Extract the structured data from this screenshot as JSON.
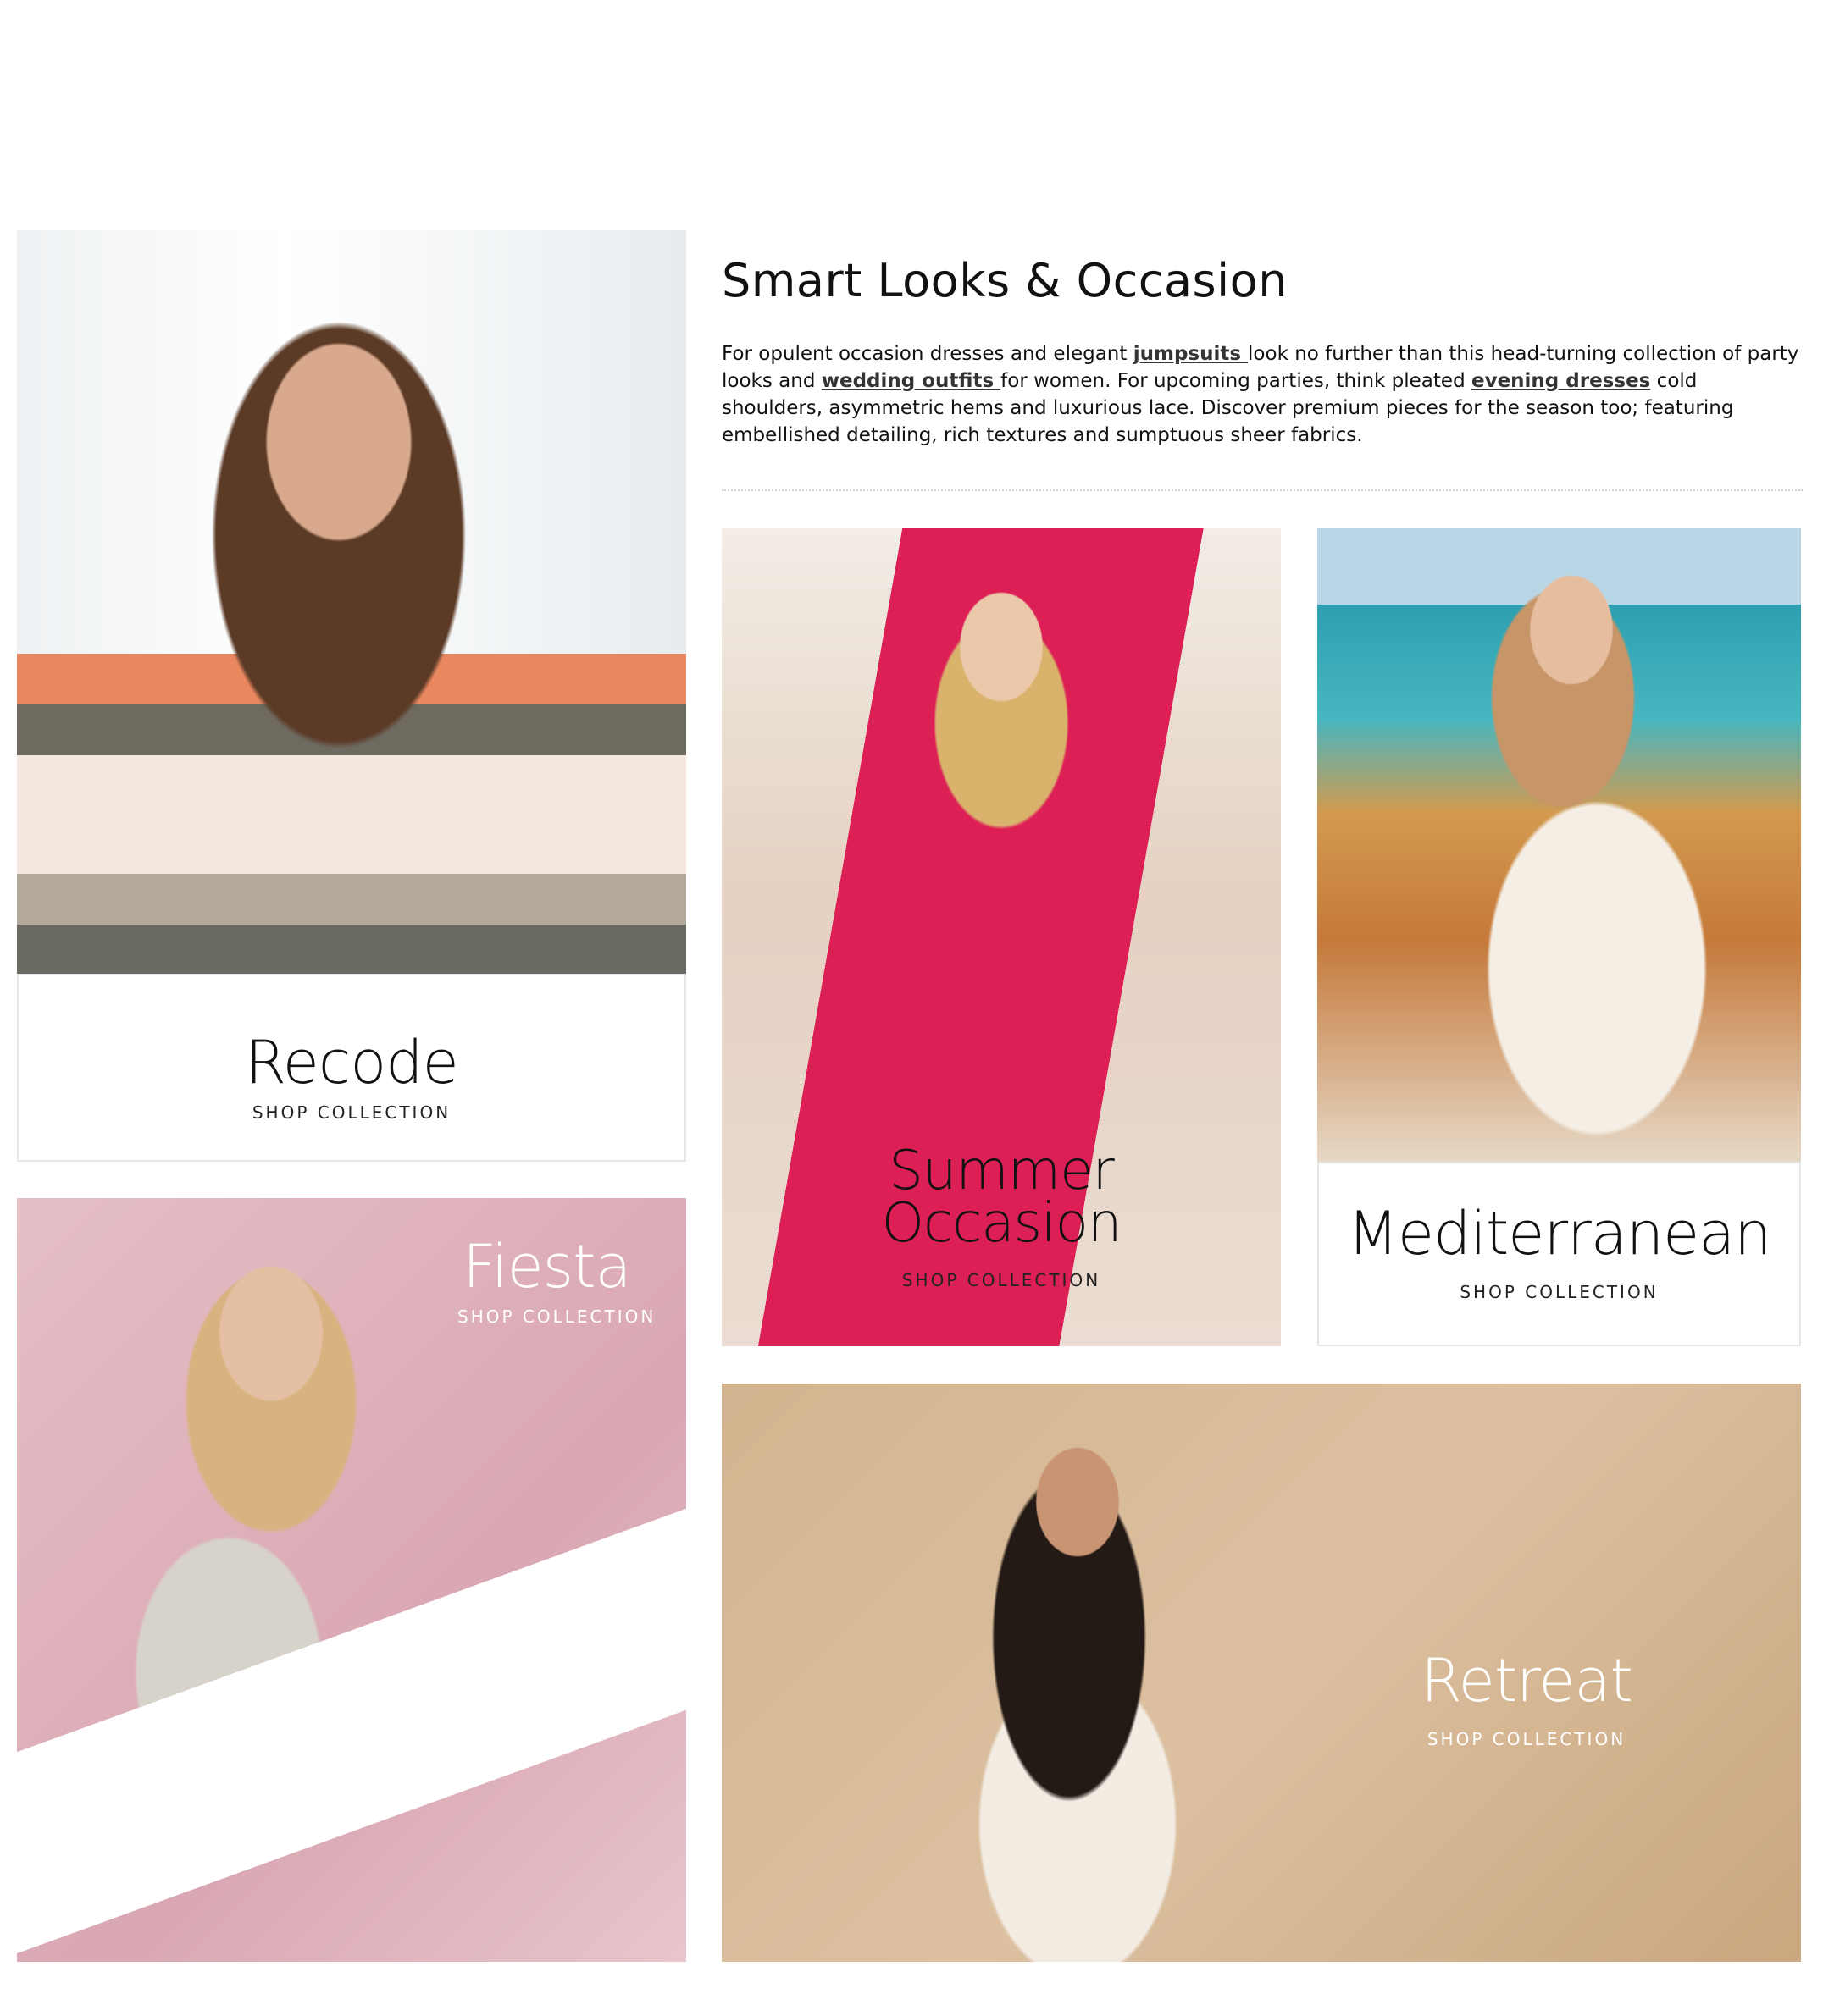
{
  "intro": {
    "title": "Smart Looks & Occasion",
    "text_1": "For opulent occasion dresses and elegant ",
    "link_jumpsuits": "jumpsuits ",
    "text_2": "look no further than this head-turning collection of party looks and ",
    "link_wedding": "wedding outfits ",
    "text_3": "for women. For upcoming parties, think pleated ",
    "link_evening": "evening dresses",
    "text_4": " cold shoulders, asymmetric hems and luxurious lace. Discover premium pieces for the season too; featuring embellished detailing, rich textures and sumptuous sheer fabrics."
  },
  "collections": {
    "recode": {
      "title": "Recode",
      "cta": "SHOP COLLECTION"
    },
    "fiesta": {
      "title": "Fiesta",
      "cta": "SHOP COLLECTION"
    },
    "summer": {
      "title_line1": "Summer",
      "title_line2": "Occasion",
      "cta": "SHOP COLLECTION"
    },
    "mediterranean": {
      "title": "Mediterranean",
      "cta": "SHOP COLLECTION"
    },
    "retreat": {
      "title": "Retreat",
      "cta": "SHOP COLLECTION"
    }
  },
  "colors": {
    "fiesta_bg": "#d9a7b3",
    "summer_dress": "#dc1f55",
    "retreat_bg": "#d3b48f"
  }
}
